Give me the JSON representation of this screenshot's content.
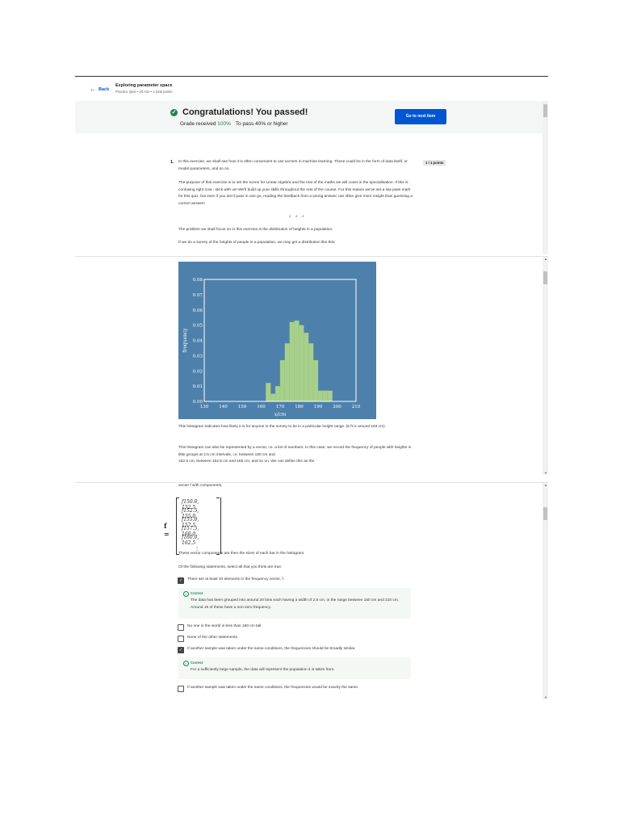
{
  "header": {
    "back_label": "Back",
    "title": "Exploring parameter space",
    "subtitle": "Practice Quiz • 20 min • 4 total points"
  },
  "banner": {
    "congrats": "Congratulations! You passed!",
    "grade_label": "Grade received",
    "grade_value": "100%",
    "to_pass": "To pass 40% or higher",
    "next_button": "Go to next item"
  },
  "question": {
    "number": "1.",
    "points": "1 / 1 points",
    "p1": "In this exercise, we shall see how it is often convenient to use vectors in machine learning. These could be in the form of data itself, or model parameters, and so on.",
    "p2": "The purpose of this exercise is to set the scene for Linear Algebra and the rest of the maths we will cover in the specialisation. If this is confusing right now - stick with us! We'll build up your skills throughout the rest of the course. For this reason we've set a low pass mark for this quiz, but even if you don't pass in one go, reading the feedback from a wrong answer can often give more insight than guessing a correct answer!",
    "dots": "* * *",
    "p3": "The problem we shall focus on in this exercise is the distribution of heights in a population.",
    "p4": "If we do a survey of the heights of people in a population, we may get a distribution like this:",
    "p5": "This histogram indicates how likely it is for anyone in the survey to be in a particular height range. (6 ft is around 183 cm)",
    "p6": "This histogram can also be represented by a vector, i.e. a list of numbers. In this case, we record the frequency of people with heights in little groups at 2.5 cm intervals, i.e. between 150 cm and",
    "p6b": "152.5 cm, between 152.5 cm and 155 cm, and so on. We can define this as the",
    "p7": "vector f with components,",
    "f_label": "f =",
    "components": [
      "f150.0, 152.5",
      "f152.5, 155.0",
      "f155.0, 157.5",
      "f157.5, 160.0",
      "f160.0, 162.5"
    ],
    "vdots": "⋮",
    "p8": "These vector components are then the sizes of each bar in the histogram.",
    "p9": "Of the following statements, select all that you think are true."
  },
  "options": [
    {
      "label": "There are at least 10 elements in the frequency vector, f.",
      "checked": true
    },
    {
      "label": "No one in the world is less than 160 cm tall.",
      "checked": false
    },
    {
      "label": "None of the other statements.",
      "checked": false
    },
    {
      "label": "If another sample was taken under the same conditions, the frequencies should be broadly similar.",
      "checked": true
    },
    {
      "label": "If another sample was taken under the same conditions, the frequencies would be exactly the same.",
      "checked": false
    }
  ],
  "feedback": [
    {
      "label": "Correct",
      "text": "The data has been grouped into around 20 bins each having a width of 2.5 cm, in the range between 150 cm and 210 cm. Around 15 of these have a non-zero frequency."
    },
    {
      "label": "Correct",
      "text": "For a sufficiently large sample, the data will represent the population it is taken from."
    }
  ],
  "colors": {
    "accent": "#0056d2",
    "success": "#1f8354",
    "chart_bg": "#4e80ac",
    "bar": "#a8d08d"
  },
  "chart_data": {
    "type": "bar",
    "xlabel": "x/cm",
    "ylabel": "frequency",
    "xlim": [
      130,
      210
    ],
    "ylim": [
      0,
      0.08
    ],
    "xticks": [
      "130",
      "140",
      "150",
      "160",
      "170",
      "180",
      "190",
      "200",
      "210"
    ],
    "yticks": [
      "0.00",
      "0.01",
      "0.02",
      "0.03",
      "0.04",
      "0.05",
      "0.06",
      "0.07",
      "0.08"
    ],
    "bin_width": 2.5,
    "bins": [
      160,
      162.5,
      165,
      167.5,
      170,
      172.5,
      175,
      177.5,
      180,
      182.5,
      185,
      187.5,
      190,
      192.5,
      195
    ],
    "values": [
      0.0,
      0.012,
      0.005,
      0.01,
      0.027,
      0.038,
      0.052,
      0.053,
      0.05,
      0.045,
      0.038,
      0.027,
      0.007,
      0.007,
      0.007
    ]
  }
}
